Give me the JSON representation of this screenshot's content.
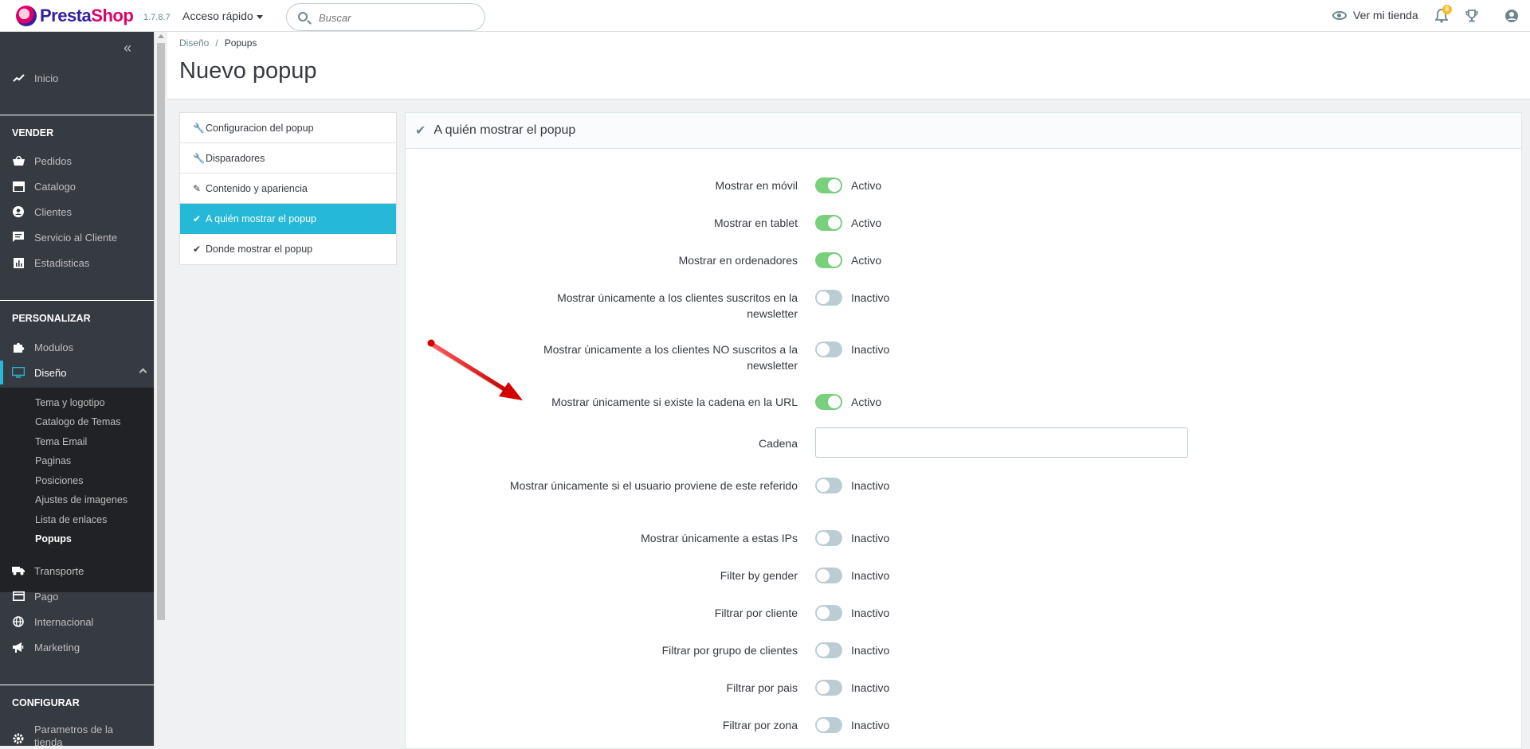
{
  "header": {
    "brand_a": "Presta",
    "brand_b": "Shop",
    "version": "1.7.8.7",
    "quick_access": "Acceso rápido",
    "search_placeholder": "Buscar",
    "view_shop": "Ver mi tienda",
    "notifications_count": "8"
  },
  "sidebar": {
    "home": "Inicio",
    "section_sell": "VENDER",
    "orders": "Pedidos",
    "catalog": "Catalogo",
    "customers": "Clientes",
    "customer_service": "Servicio al Cliente",
    "stats": "Estadisticas",
    "section_customize": "PERSONALIZAR",
    "modules": "Modulos",
    "design": "Diseño",
    "submenu": [
      "Tema y logotipo",
      "Catalogo de Temas",
      "Tema Email",
      "Paginas",
      "Posiciones",
      "Ajustes de imagenes",
      "Lista de enlaces",
      "Popups"
    ],
    "shipping": "Transporte",
    "payment": "Pago",
    "international": "Internacional",
    "marketing": "Marketing",
    "section_configure": "CONFIGURAR",
    "shop_params": "Parametros de la tienda"
  },
  "page": {
    "breadcrumb_parent": "Diseño",
    "breadcrumb_current": "Popups",
    "title": "Nuevo popup"
  },
  "tabs": [
    "Configuracion del popup",
    "Disparadores",
    "Contenido y apariencia",
    "A quién mostrar el popup",
    "Donde mostrar el popup"
  ],
  "panel": {
    "title": "A quién mostrar el popup",
    "rows": [
      {
        "label": "Mostrar en móvil",
        "state": "Activo"
      },
      {
        "label": "Mostrar en tablet",
        "state": "Activo"
      },
      {
        "label": "Mostrar en ordenadores",
        "state": "Activo"
      },
      {
        "label": "Mostrar únicamente a los clientes suscritos en la newsletter",
        "state": "Inactivo"
      },
      {
        "label": "Mostrar únicamente a los clientes NO suscritos a la newsletter",
        "state": "Inactivo"
      },
      {
        "label": "Mostrar únicamente si existe la cadena en la URL",
        "state": "Activo"
      },
      {
        "label": "Cadena",
        "value": ""
      },
      {
        "label": "Mostrar únicamente si el usuario proviene de este referido",
        "state": "Inactivo"
      },
      {
        "label": "Mostrar únicamente a estas IPs",
        "state": "Inactivo"
      },
      {
        "label": "Filter by gender",
        "state": "Inactivo"
      },
      {
        "label": "Filtrar por cliente",
        "state": "Inactivo"
      },
      {
        "label": "Filtrar por grupo de clientes",
        "state": "Inactivo"
      },
      {
        "label": "Filtrar por pais",
        "state": "Inactivo"
      },
      {
        "label": "Filtrar por zona",
        "state": "Inactivo"
      }
    ]
  },
  "colors": {
    "accent": "#25b9d7",
    "switch_on": "#78d07d",
    "switch_off": "#bbcdd2",
    "sidebar": "#363a41",
    "arrow": "#e01010"
  }
}
